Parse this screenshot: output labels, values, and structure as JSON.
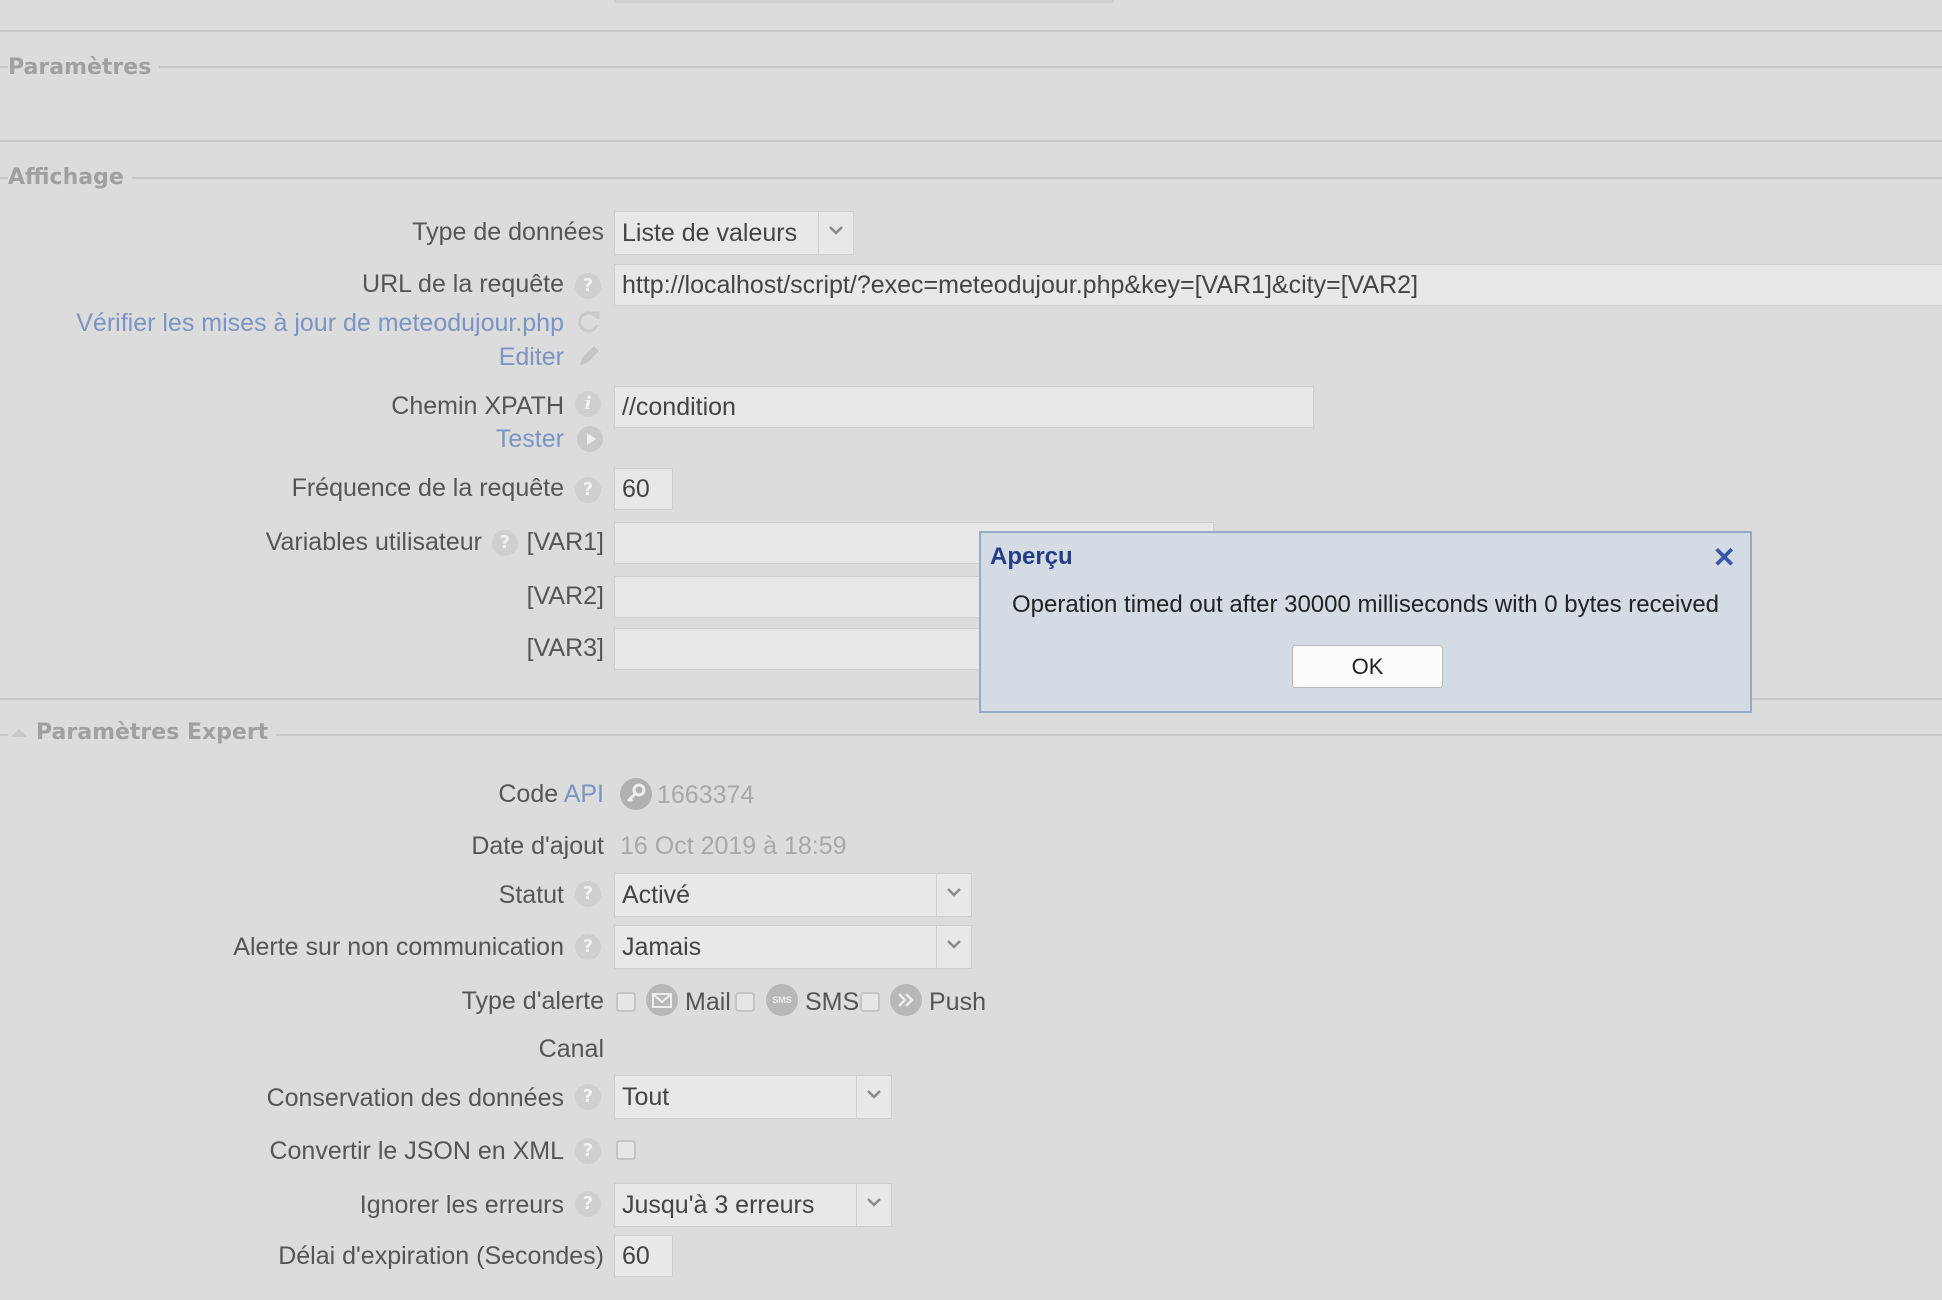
{
  "sections": {
    "parametres": "Paramètres",
    "affichage": "Affichage",
    "expert": "Paramètres Expert"
  },
  "affichage": {
    "type_donnees_label": "Type de données",
    "type_donnees_value": "Liste de valeurs",
    "url_label": "URL de la requête",
    "url_value": "http://localhost/script/?exec=meteodujour.php&key=[VAR1]&city=[VAR2]",
    "verifier_link": "Vérifier les mises à jour de meteodujour.php",
    "editer_link": "Editer",
    "xpath_label": "Chemin XPATH",
    "xpath_value": "//condition",
    "tester_link": "Tester",
    "frequence_label": "Fréquence de la requête",
    "frequence_value": "60",
    "variables_label": "Variables utilisateur",
    "var1": "[VAR1]",
    "var2": "[VAR2]",
    "var3": "[VAR3]"
  },
  "expert": {
    "code_label": "Code",
    "code_api_link": "API",
    "code_value": "1663374",
    "date_label": "Date d'ajout",
    "date_value": "16 Oct 2019 à 18:59",
    "statut_label": "Statut",
    "statut_value": "Activé",
    "alerte_label": "Alerte sur non communication",
    "alerte_value": "Jamais",
    "type_alerte_label": "Type d'alerte",
    "mail_label": "Mail",
    "sms_label": "SMS",
    "sms_icon_text": "SMS",
    "push_label": "Push",
    "canal_label": "Canal",
    "conservation_label": "Conservation des données",
    "conservation_value": "Tout",
    "json_label": "Convertir le JSON en XML",
    "ignorer_label": "Ignorer les erreurs",
    "ignorer_value": "Jusqu'à 3 erreurs",
    "delai_label": "Délai d'expiration (Secondes)",
    "delai_value": "60"
  },
  "dialog": {
    "title": "Aperçu",
    "close": "✕",
    "message": "Operation timed out after 30000 milliseconds with 0 bytes received",
    "ok": "OK"
  },
  "help_glyph": "?",
  "info_glyph": "i"
}
